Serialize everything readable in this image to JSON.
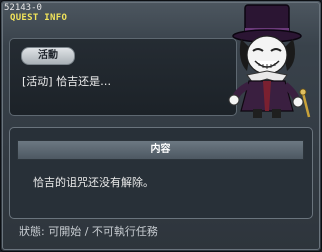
{
  "window": {
    "quest_id": "52143-0",
    "title": "QUEST INFO"
  },
  "summary": {
    "category": "活動",
    "quest_name": "[活动] 恰吉还是…"
  },
  "npc": {
    "icon": "top-hat-gentleman-npc"
  },
  "content": {
    "header": "内容",
    "text": "恰吉的诅咒还没有解除。"
  },
  "status": {
    "text": "狀態: 可開始 / 不可執行任務"
  },
  "colors": {
    "title": "#f2e45a",
    "panel_bg": "#283038",
    "header_bg": "#5c6872"
  }
}
